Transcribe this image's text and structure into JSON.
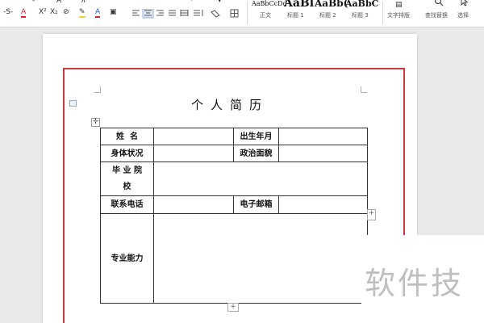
{
  "ribbon": {
    "row1_icons": [
      "-",
      "A",
      "∧",
      "·",
      "▾"
    ],
    "row2": {
      "strike": "-S-",
      "font_color_a": "A",
      "superscript": "X²",
      "subscript": "X₂",
      "clear_format": "⊘",
      "highlight": "✎",
      "font_color": "A",
      "char_border": "▣"
    },
    "styles": [
      {
        "sample": "AaBbCcDd",
        "name": "正文"
      },
      {
        "sample": "AaBl",
        "name": "标题 1"
      },
      {
        "sample": "AaBb(",
        "name": "标题 2"
      },
      {
        "sample": "AaBbC",
        "name": "标题 3"
      }
    ],
    "text_layout_label": "文字排版",
    "find_replace_label": "查找替换",
    "select_label": "选择"
  },
  "document": {
    "title": "个人简历",
    "table": {
      "name_label": "姓  名",
      "birth_label": "出生年月",
      "health_label": "身体状况",
      "political_label": "政治面貌",
      "school_label_1": "毕 业 院",
      "school_label_2": "校",
      "phone_label": "联系电话",
      "email_label": "电子邮箱",
      "skills_label": "专业能力"
    },
    "add_symbol": "+",
    "move_symbol": "✛"
  },
  "watermark": "软件技"
}
